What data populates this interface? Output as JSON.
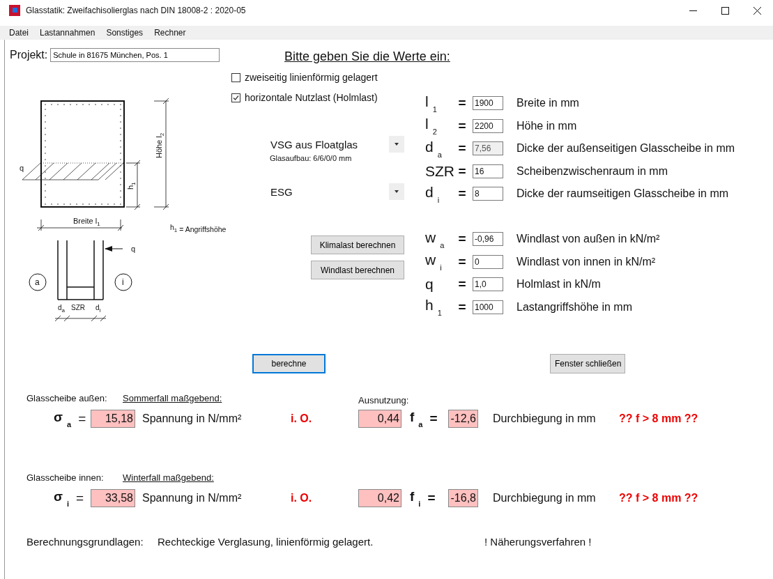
{
  "window": {
    "title": "Glasstatik: Zweifachisolierglas nach DIN 18008-2 : 2020-05"
  },
  "menu": [
    "Datei",
    "Lastannahmen",
    "Sonstiges",
    "Rechner"
  ],
  "project": {
    "label": "Projekt:",
    "value": "Schule in 81675 München, Pos. 1"
  },
  "heading": "Bitte geben Sie die Werte ein:",
  "diagram": {
    "load_label": "q",
    "height_label": {
      "text": "Höhe l",
      "sub": "2"
    },
    "h1_label": {
      "text": "h",
      "sub": "1"
    },
    "width_label": {
      "text": "Breite l",
      "sub": "1"
    },
    "h1_note": {
      "text": "h",
      "sub": "1",
      "rest": " = Angriffshöhe"
    },
    "arrow_label": "q",
    "outer_label": "a",
    "inner_label": "i",
    "da_label": {
      "text": "d",
      "sub": "a"
    },
    "szr_label": "SZR",
    "di_label": {
      "text": "d",
      "sub": "i"
    }
  },
  "options": [
    {
      "label": "zweiseitig linienförmig gelagert",
      "checked": false
    },
    {
      "label": "horizontale Nutzlast (Holmlast)",
      "checked": true
    }
  ],
  "glass_outer": {
    "value": "VSG aus Floatglas",
    "note": "Glasaufbau: 6/6/0/0 mm"
  },
  "glass_inner": {
    "value": "ESG"
  },
  "load_buttons": [
    "Klimalast berechnen",
    "Windlast berechnen"
  ],
  "glass_params": [
    {
      "symbol": "l$_{1}$",
      "eq": "=",
      "value": "1900",
      "disabled": false,
      "label": "Breite in mm"
    },
    {
      "symbol": "l$_{2}$",
      "eq": "=",
      "value": "2200",
      "disabled": false,
      "label": "Höhe in mm"
    },
    {
      "symbol": "d$_{a}$",
      "eq": "=",
      "value": "7,56",
      "disabled": true,
      "label": "Dicke der außenseitigen Glasscheibe in mm"
    },
    {
      "symbol": "SZR",
      "eq": "=",
      "value": "16",
      "disabled": false,
      "label": "Scheibenzwischenraum in mm"
    },
    {
      "symbol": "d$_{i}$",
      "eq": "=",
      "value": "8",
      "disabled": false,
      "label": "Dicke der raumseitigen Glasscheibe in mm"
    }
  ],
  "load_params": [
    {
      "symbol": "w$_{a}$",
      "eq": "=",
      "value": "-0,96",
      "disabled": false,
      "label": "Windlast von außen in kN/m²"
    },
    {
      "symbol": "w$_{i}$",
      "eq": "=",
      "value": "0",
      "disabled": false,
      "label": "Windlast von innen in kN/m²"
    },
    {
      "symbol": "q",
      "eq": "=",
      "value": "1,0",
      "disabled": false,
      "label": "Holmlast in kN/m"
    },
    {
      "symbol": "h$_{1}$",
      "eq": "=",
      "value": "1000",
      "disabled": false,
      "label": "Lastangriffshöhe in mm"
    }
  ],
  "actions": [
    {
      "label": "berechne",
      "focused": true
    },
    {
      "label": "Fenster schließen",
      "focused": false
    }
  ],
  "results": [
    {
      "pane": "Glasscheibe außen:",
      "case": "Sommerfall maßgebend:",
      "utilization_label": "Ausnutzung:",
      "symbol": "σ$_{a}$",
      "eq": "=",
      "stress": "15,18",
      "stress_unit": "Spannung in N/mm²",
      "status": "i. O.",
      "utilization": "0,44",
      "deflection_symbol": "f$_{a}$",
      "deflection_eq": "=",
      "deflection": "-12,6",
      "deflection_unit": "Durchbiegung in mm",
      "warning": "?? f > 8 mm ??"
    },
    {
      "pane": "Glasscheibe innen:",
      "case": "Winterfall maßgebend:",
      "symbol": "σ$_{i}$",
      "eq": "=",
      "stress": "33,58",
      "stress_unit": "Spannung in N/mm²",
      "status": "i. O.",
      "utilization": "0,42",
      "deflection_symbol": "f$_{i}$",
      "deflection_eq": "=",
      "deflection": "-16,8",
      "deflection_unit": "Durchbiegung in mm",
      "warning": "?? f > 8 mm ??"
    }
  ],
  "footer": {
    "label": "Berechnungsgrundlagen:",
    "text": "Rechteckige Verglasung, linienförmig gelagert.",
    "note": "! Näherungsverfahren !"
  }
}
